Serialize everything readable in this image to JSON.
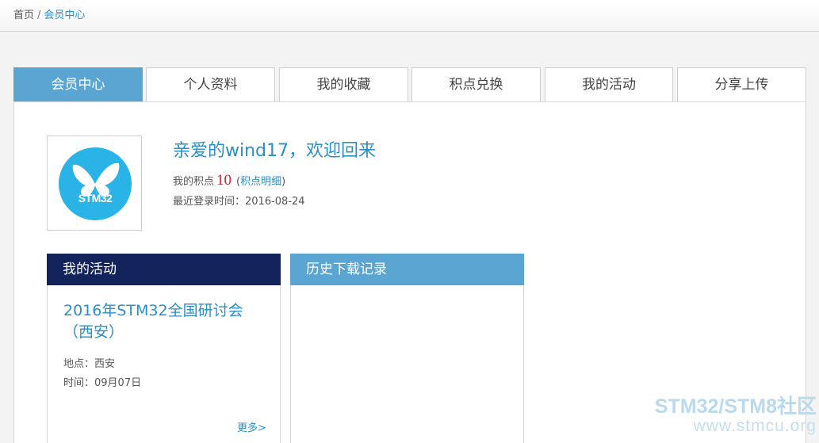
{
  "breadcrumb": {
    "home": "首页",
    "separator": "/",
    "current": "会员中心"
  },
  "tabs": [
    {
      "label": "会员中心",
      "active": true
    },
    {
      "label": "个人资料",
      "active": false
    },
    {
      "label": "我的收藏",
      "active": false
    },
    {
      "label": "积点兑换",
      "active": false
    },
    {
      "label": "我的活动",
      "active": false
    },
    {
      "label": "分享上传",
      "active": false
    }
  ],
  "profile": {
    "avatar_text": "STM32",
    "avatar_icon": "butterfly-icon",
    "welcome": "亲爱的wind17，欢迎回来",
    "points_label": "我的积点",
    "points_value": "10",
    "points_link_open": "(",
    "points_link": "积点明细",
    "points_link_close": ")",
    "last_login": "最近登录时间：2016-08-24"
  },
  "activity_card": {
    "title": "我的活动",
    "event_title": "2016年STM32全国研讨会（西安）",
    "location": "地点：西安",
    "time": "时间：09月07日",
    "more": "更多>"
  },
  "downloads_card": {
    "title": "历史下载记录"
  },
  "watermark": {
    "main": "STM32/STM8社区",
    "sub": "www.stmcu.org"
  },
  "colors": {
    "accent_blue": "#5ba5d3",
    "link_blue": "#2a8fc6",
    "navy": "#13235b",
    "points_red": "#c0282c",
    "avatar_blue": "#2ab3e6"
  }
}
